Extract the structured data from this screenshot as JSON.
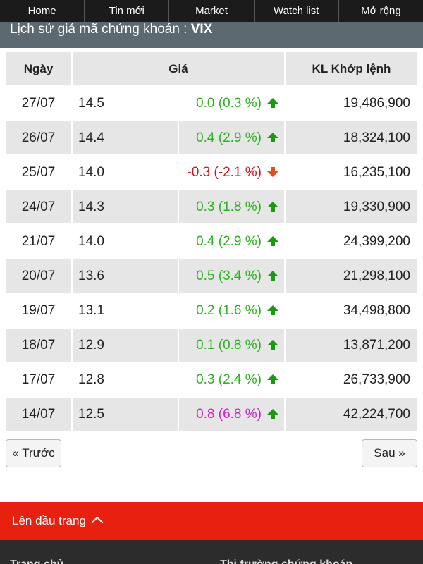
{
  "nav": {
    "items": [
      "Home",
      "Tin mới",
      "Market",
      "Watch list",
      "Mở rộng"
    ]
  },
  "title": {
    "prefix": "Lịch sử giá mã chứng khoán : ",
    "code": "VIX"
  },
  "table": {
    "headers": {
      "date": "Ngày",
      "price": "Giá",
      "volume": "KL Khớp lệnh"
    },
    "rows": [
      {
        "date": "27/07",
        "price": "14.5",
        "change": "0.0 (0.3 %)",
        "direction": "up",
        "volume": "19,486,900"
      },
      {
        "date": "26/07",
        "price": "14.4",
        "change": "0.4 (2.9 %)",
        "direction": "up",
        "volume": "18,324,100"
      },
      {
        "date": "25/07",
        "price": "14.0",
        "change": "-0.3 (-2.1 %)",
        "direction": "down",
        "volume": "16,235,100"
      },
      {
        "date": "24/07",
        "price": "14.3",
        "change": "0.3 (1.8 %)",
        "direction": "up",
        "volume": "19,330,900"
      },
      {
        "date": "21/07",
        "price": "14.0",
        "change": "0.4 (2.9 %)",
        "direction": "up",
        "volume": "24,399,200"
      },
      {
        "date": "20/07",
        "price": "13.6",
        "change": "0.5 (3.4 %)",
        "direction": "up",
        "volume": "21,298,100"
      },
      {
        "date": "19/07",
        "price": "13.1",
        "change": "0.2 (1.6 %)",
        "direction": "up",
        "volume": "34,498,800"
      },
      {
        "date": "18/07",
        "price": "12.9",
        "change": "0.1 (0.8 %)",
        "direction": "up",
        "volume": "13,871,200"
      },
      {
        "date": "17/07",
        "price": "12.8",
        "change": "0.3 (2.4 %)",
        "direction": "up",
        "volume": "26,733,900"
      },
      {
        "date": "14/07",
        "price": "12.5",
        "change": "0.8 (6.8 %)",
        "direction": "ceiling",
        "volume": "42,224,700"
      }
    ]
  },
  "pager": {
    "prev_label": "« Trước",
    "next_label": "Sau »"
  },
  "back_to_top": {
    "label": "Lên đầu trang"
  },
  "colors": {
    "up": "#2bb41f",
    "down": "#d0161b",
    "ceiling": "#cc22cc",
    "accent": "#e8200f"
  },
  "icons": {
    "up": "arrow-up-icon",
    "down": "arrow-down-icon",
    "back_to_top": "chevron-up-icon"
  }
}
